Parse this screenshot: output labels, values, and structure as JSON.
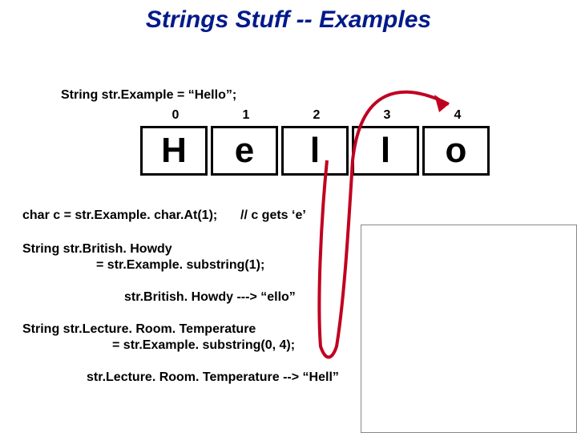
{
  "title": "Strings Stuff -- Examples",
  "decl": "String str.Example = “Hello”;",
  "indices": [
    "0",
    "1",
    "2",
    "3",
    "4"
  ],
  "letters": [
    "H",
    "e",
    "l",
    "l",
    "o"
  ],
  "charAt": {
    "code": "char c = str.Example. char.At(1);",
    "comment": "// c gets ‘e’"
  },
  "britishHowdy": {
    "decl1": "String str.British. Howdy",
    "decl2": "= str.Example. substring(1);",
    "result": "str.British. Howdy --->  “ello”"
  },
  "lectureRoom": {
    "decl1": "String str.Lecture. Room. Temperature",
    "decl2": "= str.Example. substring(0, 4);",
    "result": "str.Lecture. Room. Temperature -->  “Hell”"
  }
}
